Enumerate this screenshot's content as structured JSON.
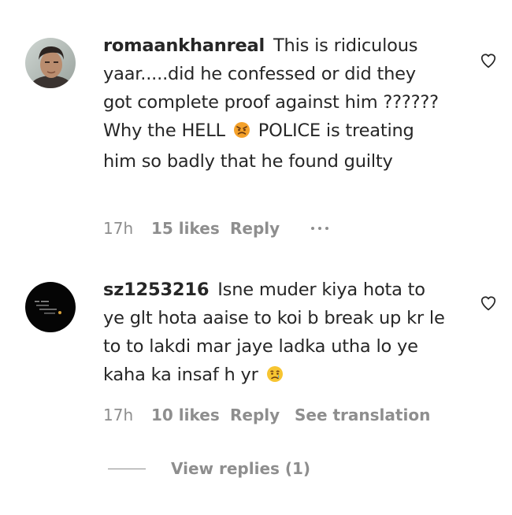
{
  "comments": [
    {
      "username": "romaankhanreal",
      "text_before_emoji": "This is ridiculous yaar.....did he confessed or did they got complete proof against him ?????? Why the HELL",
      "emoji": "angry-face-emoji",
      "text_after_emoji": "POLICE is treating him so badly that he found guilty",
      "time": "17h",
      "likes": "15 likes",
      "reply_label": "Reply",
      "more_icon": "ellipsis-icon"
    },
    {
      "username": "sz1253216",
      "text_before_emoji": "Isne muder kiya hota to ye glt hota aaise to koi b break up kr le to to lakdi mar jaye ladka utha lo ye kaha ka insaf h yr",
      "emoji": "crying-face-emoji",
      "text_after_emoji": "",
      "time": "17h",
      "likes": "10 likes",
      "reply_label": "Reply",
      "translation_label": "See translation"
    }
  ],
  "view_replies_label": "View replies (1)",
  "colors": {
    "text": "#262626",
    "secondary": "#8e8e8e",
    "background": "#ffffff"
  }
}
